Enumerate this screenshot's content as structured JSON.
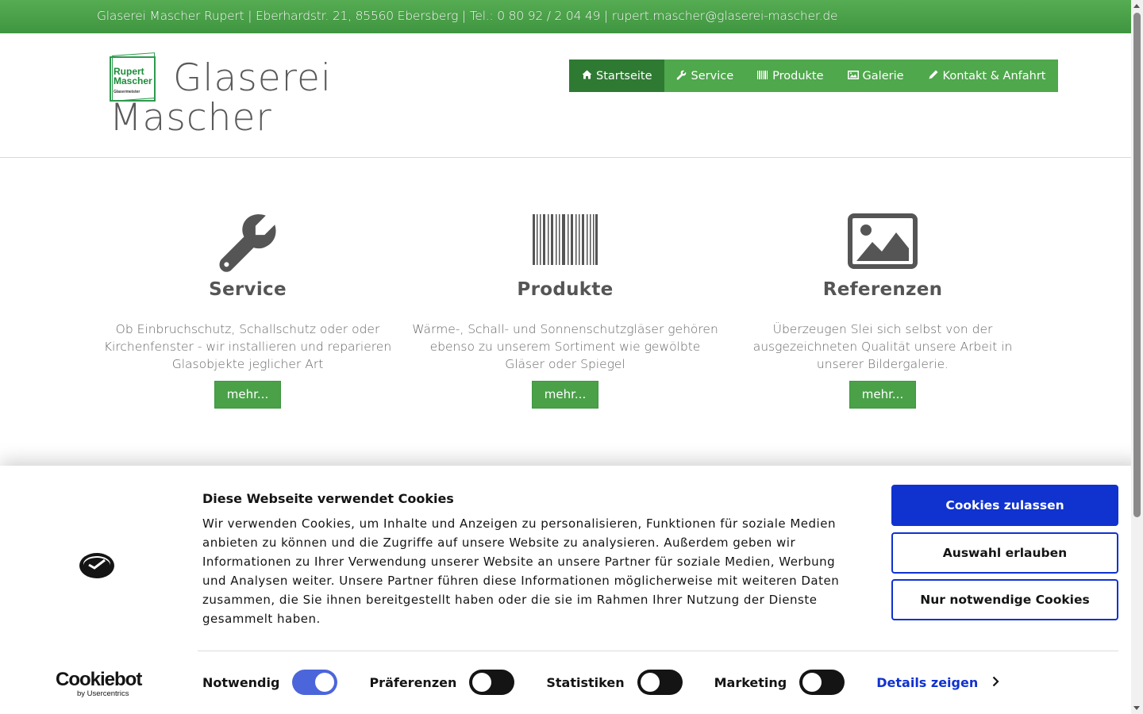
{
  "topbar": {
    "contact": "Glaserei Mascher Rupert | Eberhardstr. 21, 85560 Ebersberg | Tel.: 0 80 92 / 2 04 49 | rupert.mascher@glaserei-mascher.de"
  },
  "logo": {
    "word1": "Rupert",
    "word2": "Mascher",
    "word3": "Glasermeister"
  },
  "site_title": {
    "line1": "Glaserei",
    "line2": "Mascher"
  },
  "nav": {
    "items": [
      {
        "label": "Startseite",
        "icon": "home-icon"
      },
      {
        "label": "Service",
        "icon": "wrench-icon"
      },
      {
        "label": "Produkte",
        "icon": "barcode-icon"
      },
      {
        "label": "Galerie",
        "icon": "image-icon"
      },
      {
        "label": "Kontakt & Anfahrt",
        "icon": "pencil-icon"
      }
    ]
  },
  "features": [
    {
      "icon": "wrench-icon",
      "title": "Service",
      "text": "Ob Einbruchschutz, Schallschutz oder oder Kirchenfenster - wir installieren und reparieren Glasobjekte jeglicher Art",
      "button": "mehr..."
    },
    {
      "icon": "barcode-icon",
      "title": "Produkte",
      "text": "Wärme-, Schall- und Sonnenschutzgläser gehören ebenso zu unserem Sortiment wie gewölbte Gläser oder Spiegel",
      "button": "mehr..."
    },
    {
      "icon": "image-icon",
      "title": "Referenzen",
      "text": "Überzeugen Slei sich selbst von der ausgezeichneten Qualität unsere Arbeit in unserer Bildergalerie.",
      "button": "mehr..."
    }
  ],
  "cookie": {
    "title": "Diese Webseite verwendet Cookies",
    "body": "Wir verwenden Cookies, um Inhalte und Anzeigen zu personalisieren, Funktionen für soziale Medien anbieten zu können und die Zugriffe auf unsere Website zu analysieren. Außerdem geben wir Informationen zu Ihrer Verwendung unserer Website an unsere Partner für soziale Medien, Werbung und Analysen weiter. Unsere Partner führen diese Informationen möglicherweise mit weiteren Daten zusammen, die Sie ihnen bereitgestellt haben oder die sie im Rahmen Ihrer Nutzung der Dienste gesammelt haben.",
    "buttons": {
      "allow_all": "Cookies zulassen",
      "allow_selection": "Auswahl erlauben",
      "necessary_only": "Nur notwendige Cookies"
    },
    "toggles": [
      {
        "label": "Notwendig",
        "on": true
      },
      {
        "label": "Präferenzen",
        "on": false
      },
      {
        "label": "Statistiken",
        "on": false
      },
      {
        "label": "Marketing",
        "on": false
      }
    ],
    "details_label": "Details zeigen",
    "brand_name": "Cookiebot",
    "brand_by": "by Usercentrics"
  },
  "colors": {
    "brand_green": "#4aa148",
    "nav_active": "#2f7a33",
    "cookie_blue": "#1032cf"
  }
}
